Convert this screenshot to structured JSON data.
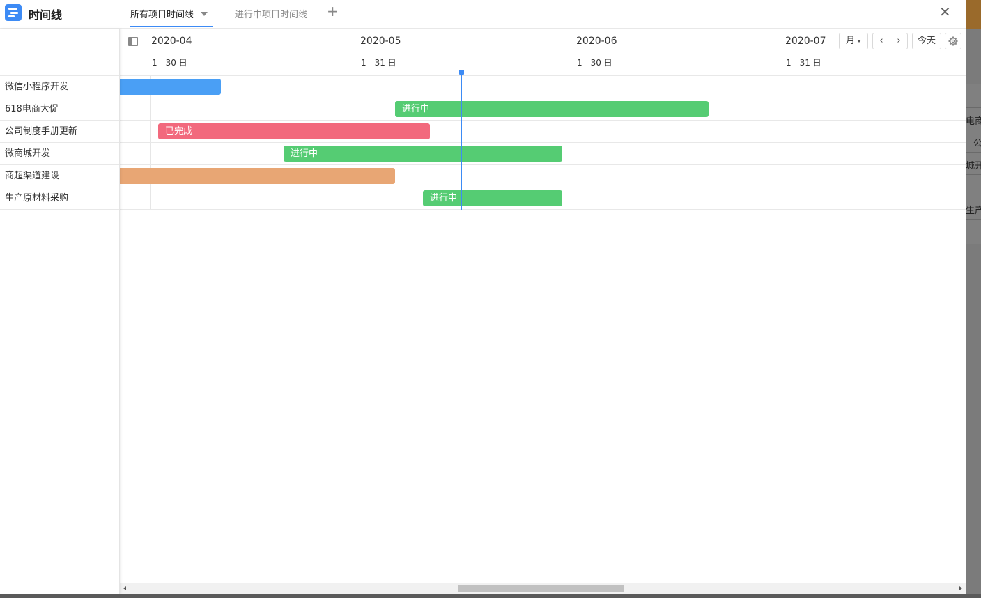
{
  "app": {
    "title": "时间线"
  },
  "tabs": [
    {
      "label": "所有项目时间线",
      "active": true
    },
    {
      "label": "进行中项目时间线",
      "active": false
    }
  ],
  "tab_add_icon": "plus-icon",
  "close_icon": "close-icon",
  "controls": {
    "view_mode": "月",
    "prev_icon": "chevron-left-icon",
    "next_icon": "chevron-right-icon",
    "today_label": "今天",
    "settings_icon": "gear-icon"
  },
  "months": [
    {
      "name": "2020-04",
      "range": "1 - 30 日"
    },
    {
      "name": "2020-05",
      "range": "1 - 31 日"
    },
    {
      "name": "2020-06",
      "range": "1 - 30 日"
    },
    {
      "name": "2020-07",
      "range": "1 - 31 日"
    }
  ],
  "projects": [
    {
      "name": "微信小程序开发",
      "status": "",
      "color": "#4a9ff5"
    },
    {
      "name": "618电商大促",
      "status": "进行中",
      "color": "#55cc73"
    },
    {
      "name": "公司制度手册更新",
      "status": "已完成",
      "color": "#f2697d"
    },
    {
      "name": "微商城开发",
      "status": "进行中",
      "color": "#55cc73"
    },
    {
      "name": "商超渠道建设",
      "status": "",
      "color": "#e8a674"
    },
    {
      "name": "生产原材料采购",
      "status": "进行中",
      "color": "#55cc73"
    }
  ],
  "background_fragments": [
    "电商",
    "公",
    "城开",
    "生产"
  ]
}
